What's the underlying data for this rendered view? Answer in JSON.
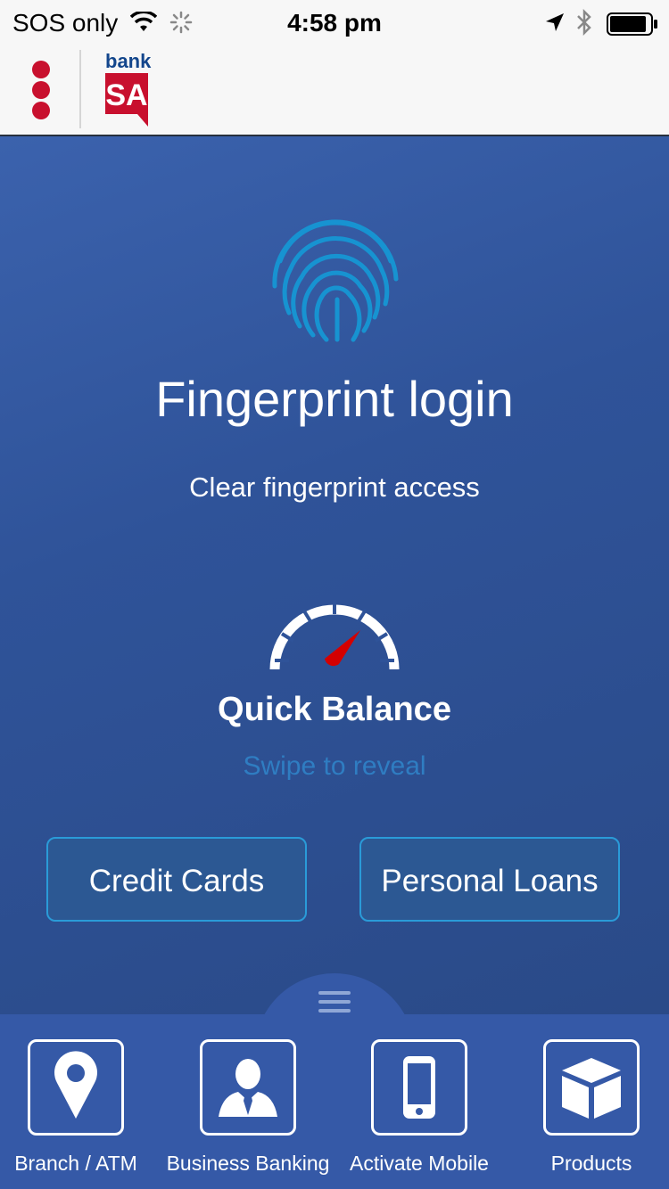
{
  "status_bar": {
    "carrier": "SOS only",
    "time": "4:58 pm",
    "icons": [
      "wifi-icon",
      "activity-spinner-icon",
      "location-arrow-icon",
      "bluetooth-icon",
      "battery-icon"
    ]
  },
  "header": {
    "logo_word": "bank",
    "logo_letters": "SA",
    "brand_color": "#c8102e",
    "brand_text_color": "#13468c"
  },
  "main": {
    "title": "Fingerprint login",
    "subtitle": "Clear fingerprint access",
    "quick_balance": {
      "title": "Quick Balance",
      "hint": "Swipe to reveal"
    },
    "buttons": {
      "credit_cards": "Credit Cards",
      "personal_loans": "Personal Loans"
    }
  },
  "tabs": [
    {
      "label": "Branch / ATM",
      "icon": "map-pin-icon"
    },
    {
      "label": "Business Banking",
      "icon": "business-person-icon"
    },
    {
      "label": "Activate Mobile",
      "icon": "mobile-phone-icon"
    },
    {
      "label": "Products",
      "icon": "box-icon"
    }
  ],
  "colors": {
    "background": "#2d4f8f",
    "tab_bar": "#3559a7",
    "accent_blue": "#2a9bd8",
    "gauge_needle": "#cc0000"
  }
}
